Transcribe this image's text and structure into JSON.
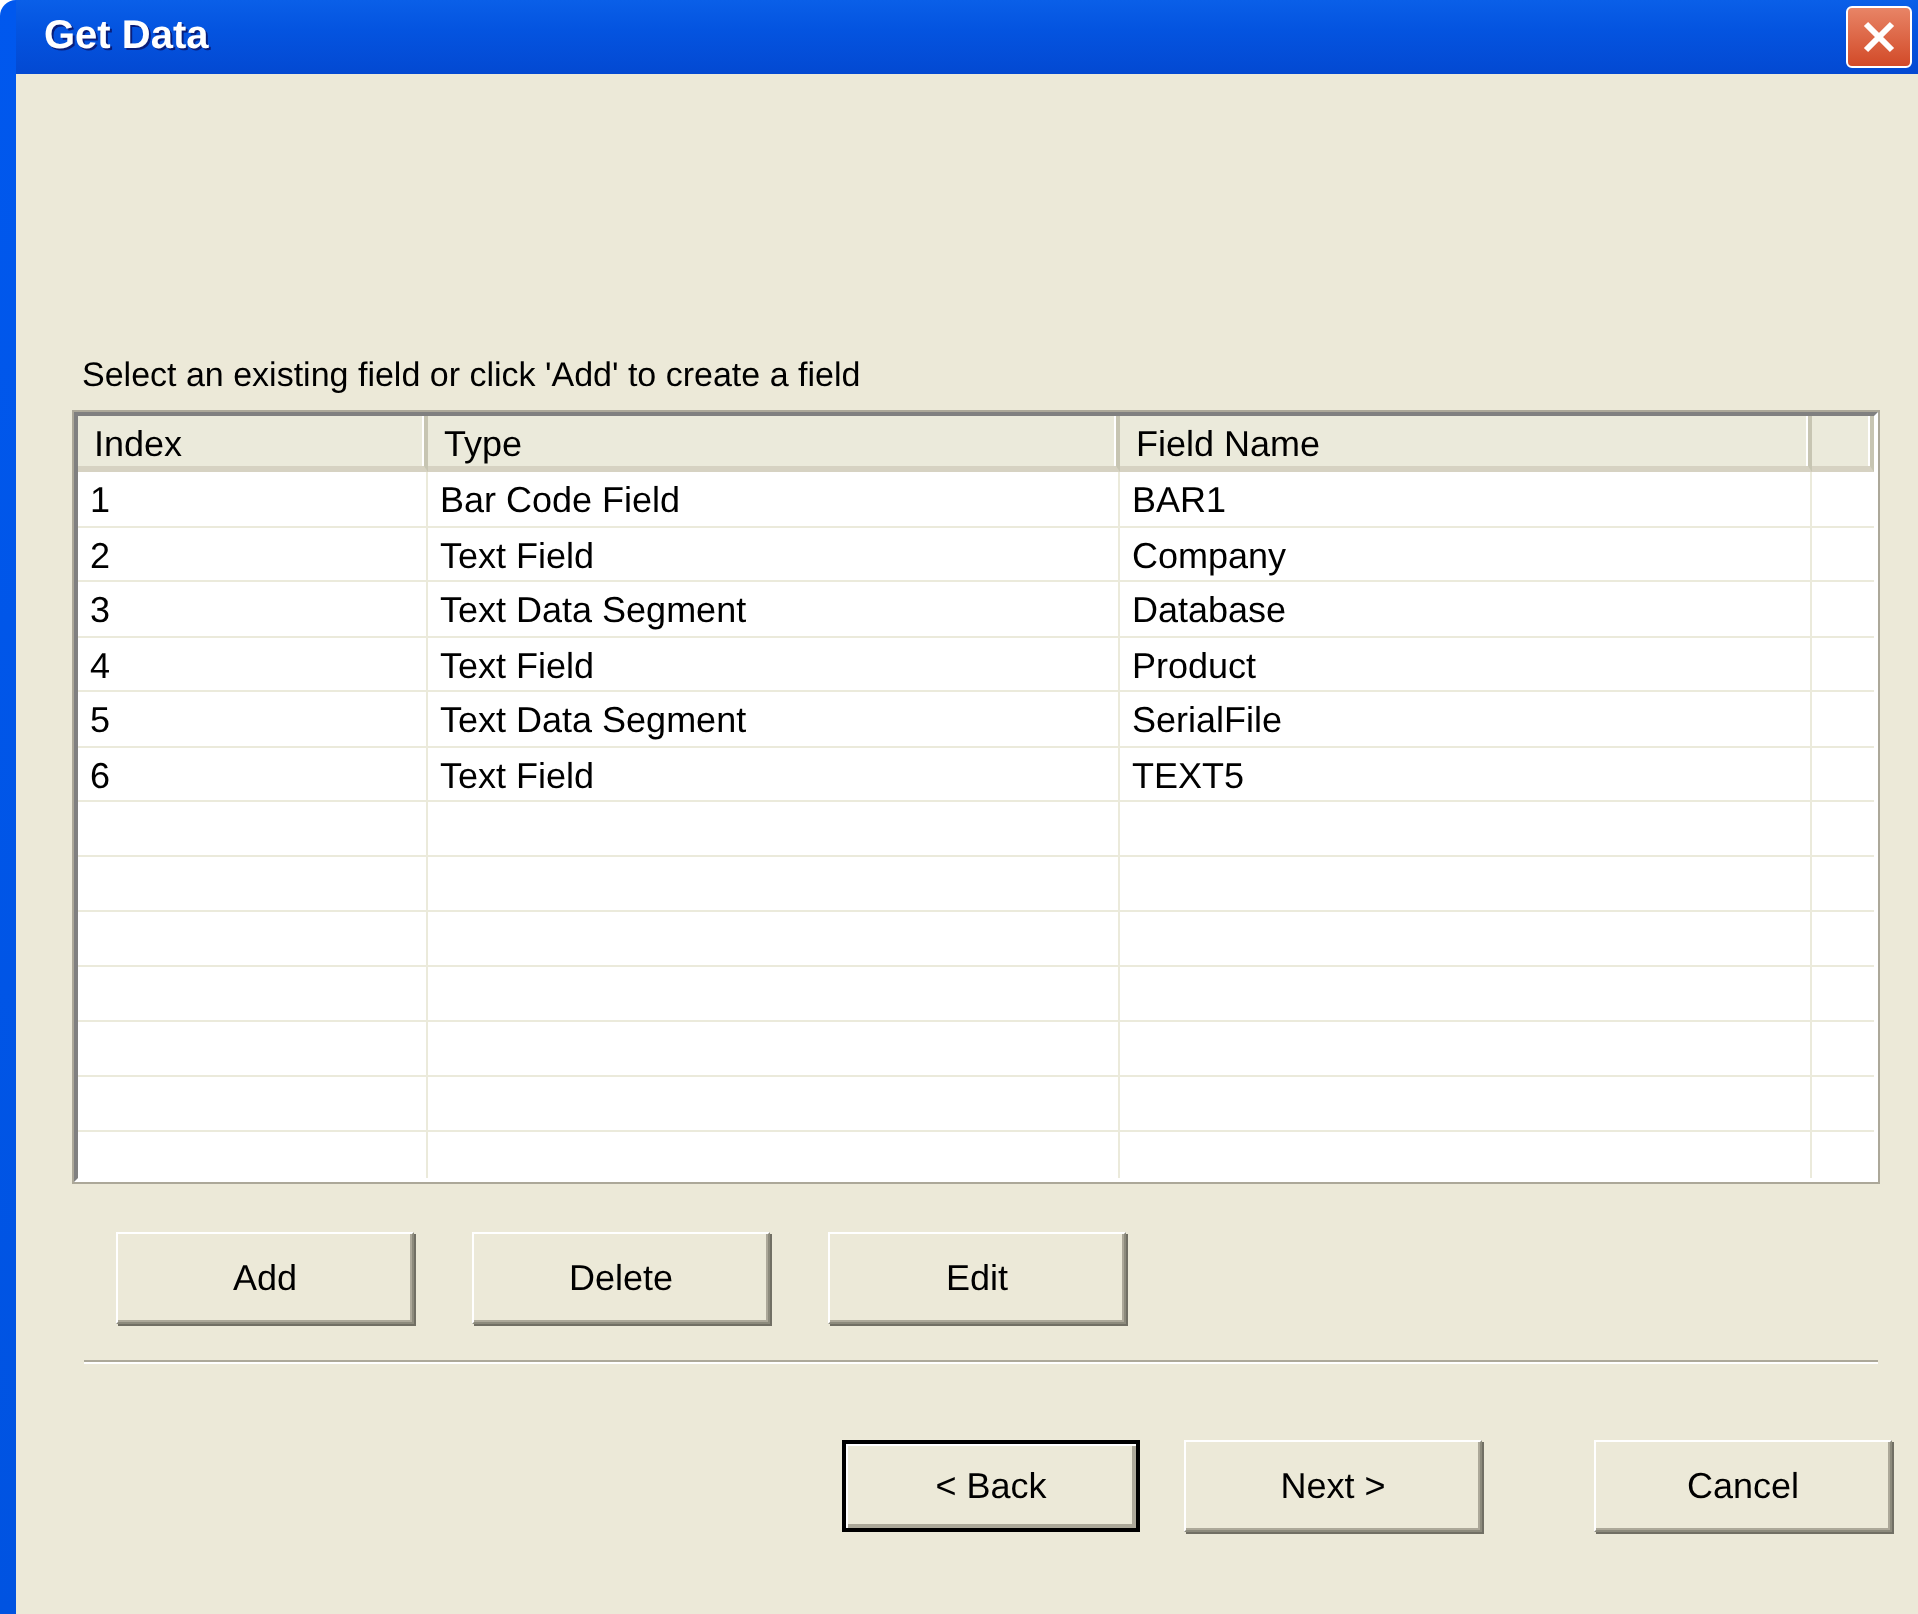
{
  "window": {
    "title": "Get Data"
  },
  "instruction": "Select an existing field or click 'Add' to create a field",
  "table": {
    "columns": [
      "Index",
      "Type",
      "Field Name"
    ],
    "rows": [
      {
        "index": "1",
        "type": "Bar Code Field",
        "field_name": "BAR1"
      },
      {
        "index": "2",
        "type": "Text Field",
        "field_name": "Company"
      },
      {
        "index": "3",
        "type": "Text Data Segment",
        "field_name": "Database"
      },
      {
        "index": "4",
        "type": "Text Field",
        "field_name": "Product"
      },
      {
        "index": "5",
        "type": "Text Data Segment",
        "field_name": "SerialFile"
      },
      {
        "index": "6",
        "type": "Text Field",
        "field_name": "TEXT5"
      }
    ]
  },
  "field_buttons": [
    {
      "label": "Add",
      "default": false
    },
    {
      "label": "Delete",
      "default": false
    },
    {
      "label": "Edit",
      "default": false
    }
  ],
  "nav_buttons": [
    {
      "label": "< Back",
      "default": true
    },
    {
      "label": "Next >",
      "default": false
    },
    {
      "label": "Cancel",
      "default": false
    }
  ]
}
